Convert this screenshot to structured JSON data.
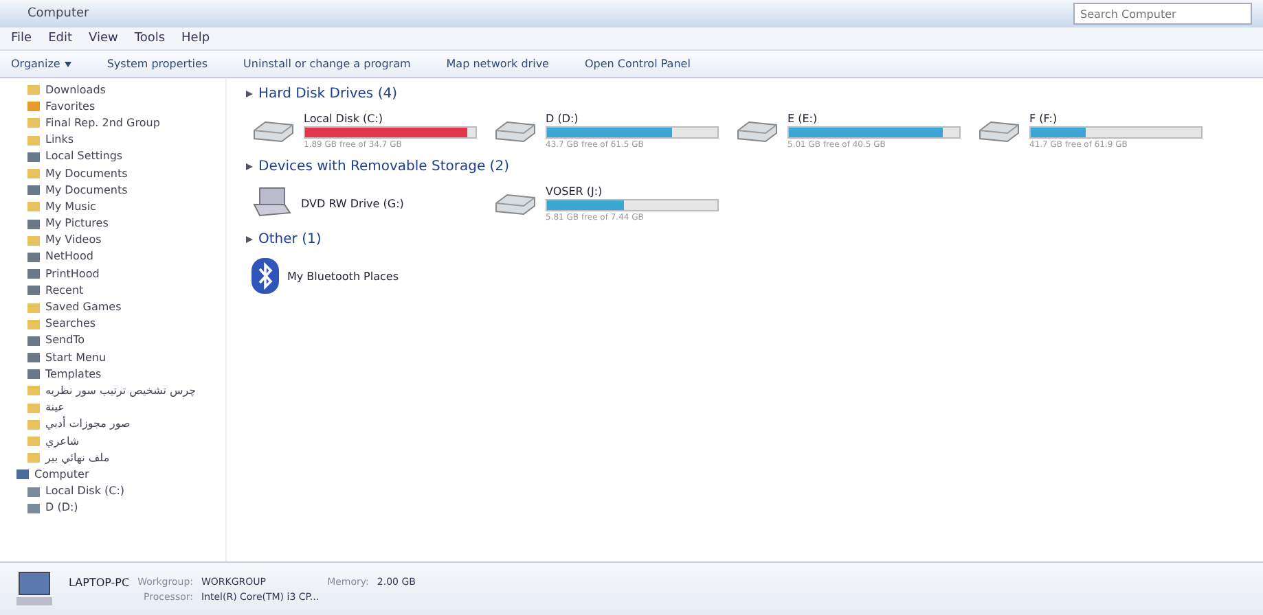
{
  "address": {
    "path": "Computer"
  },
  "search": {
    "placeholder": "Search Computer"
  },
  "menu": [
    "File",
    "Edit",
    "View",
    "Tools",
    "Help"
  ],
  "commands": [
    {
      "label": "Organize",
      "dropdown": true
    },
    {
      "label": "System properties",
      "dropdown": false
    },
    {
      "label": "Uninstall or change a program",
      "dropdown": false
    },
    {
      "label": "Map network drive",
      "dropdown": false
    },
    {
      "label": "Open Control Panel",
      "dropdown": false
    }
  ],
  "sidebar": {
    "items": [
      {
        "label": "Downloads",
        "kind": "folder"
      },
      {
        "label": "Favorites",
        "kind": "star"
      },
      {
        "label": "Final Rep. 2nd Group",
        "kind": "folder"
      },
      {
        "label": "Links",
        "kind": "folder"
      },
      {
        "label": "Local Settings",
        "kind": "shortcut"
      },
      {
        "label": "My Documents",
        "kind": "folder"
      },
      {
        "label": "My Documents",
        "kind": "shortcut"
      },
      {
        "label": "My Music",
        "kind": "folder"
      },
      {
        "label": "My Pictures",
        "kind": "shortcut"
      },
      {
        "label": "My Videos",
        "kind": "folder"
      },
      {
        "label": "NetHood",
        "kind": "shortcut"
      },
      {
        "label": "PrintHood",
        "kind": "shortcut"
      },
      {
        "label": "Recent",
        "kind": "shortcut"
      },
      {
        "label": "Saved Games",
        "kind": "folder"
      },
      {
        "label": "Searches",
        "kind": "folder"
      },
      {
        "label": "SendTo",
        "kind": "shortcut"
      },
      {
        "label": "Start Menu",
        "kind": "shortcut"
      },
      {
        "label": "Templates",
        "kind": "shortcut"
      },
      {
        "label": "چرس تشخیص ترتیب سور نظریه",
        "kind": "folder"
      },
      {
        "label": "عينة",
        "kind": "folder"
      },
      {
        "label": "صور مجوزات أدبي",
        "kind": "folder"
      },
      {
        "label": "شاعري",
        "kind": "folder"
      },
      {
        "label": "ملف نهائي بير",
        "kind": "folder"
      },
      {
        "label": "Computer",
        "kind": "computer"
      },
      {
        "label": "Local Disk (C:)",
        "kind": "disk"
      },
      {
        "label": "D (D:)",
        "kind": "disk"
      }
    ]
  },
  "groups": [
    {
      "title": "Hard Disk Drives (4)",
      "items": [
        {
          "kind": "drive",
          "name": "Local Disk (C:)",
          "level": 0.95,
          "low_space": true,
          "free": "1.89 GB free of 34.7 GB"
        },
        {
          "kind": "drive",
          "name": "D (D:)",
          "level": 0.73,
          "low_space": false,
          "free": "43.7 GB free of 61.5 GB"
        },
        {
          "kind": "drive",
          "name": "E (E:)",
          "level": 0.9,
          "low_space": false,
          "free": "5.01 GB free of 40.5 GB"
        },
        {
          "kind": "drive",
          "name": "F (F:)",
          "level": 0.32,
          "low_space": false,
          "free": "41.7 GB free of 61.9 GB"
        }
      ]
    },
    {
      "title": "Devices with Removable Storage (2)",
      "items": [
        {
          "kind": "optical",
          "name": "DVD RW Drive (G:)"
        },
        {
          "kind": "drive",
          "name": "VOSER (J:)",
          "level": 0.45,
          "low_space": false,
          "free": "5.81 GB free of 7.44 GB"
        }
      ]
    },
    {
      "title": "Other (1)",
      "items": [
        {
          "kind": "bluetooth",
          "name": "My Bluetooth Places"
        }
      ]
    }
  ],
  "details": {
    "name": "LAPTOP-PC",
    "fields": [
      {
        "label": "Workgroup:",
        "value": "WORKGROUP"
      },
      {
        "label": "Memory:",
        "value": "2.00 GB"
      },
      {
        "label": "Processor:",
        "value": "Intel(R) Core(TM) i3 CP..."
      }
    ]
  }
}
